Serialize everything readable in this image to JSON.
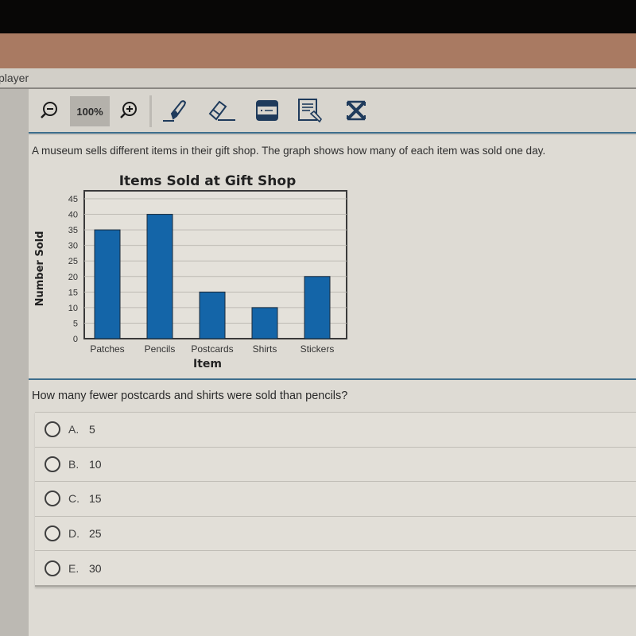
{
  "window": {
    "title_fragment": "player"
  },
  "toolbar": {
    "zoom_level": "100%",
    "tools": [
      {
        "name": "zoom-out",
        "icon": "zoom-out-icon"
      },
      {
        "name": "zoom-in",
        "icon": "zoom-in-icon"
      },
      {
        "name": "highlighter",
        "icon": "highlighter-icon"
      },
      {
        "name": "eraser",
        "icon": "eraser-icon"
      },
      {
        "name": "line-reader",
        "icon": "line-reader-icon"
      },
      {
        "name": "notepad",
        "icon": "notepad-icon"
      },
      {
        "name": "answer-eliminator",
        "icon": "answer-eliminator-icon"
      }
    ],
    "accent_color": "#1f3b5c"
  },
  "passage": "A museum sells different items in their gift shop. The graph shows how many of each item was sold one day.",
  "chart_data": {
    "type": "bar",
    "title": "Items Sold at Gift Shop",
    "xlabel": "Item",
    "ylabel": "Number Sold",
    "categories": [
      "Patches",
      "Pencils",
      "Postcards",
      "Shirts",
      "Stickers"
    ],
    "values": [
      35,
      40,
      15,
      10,
      20
    ],
    "ylim": [
      0,
      45
    ],
    "yticks": [
      0,
      5,
      10,
      15,
      20,
      25,
      30,
      35,
      40,
      45
    ],
    "grid": true,
    "bar_color": "#1465a8"
  },
  "question": "How many fewer postcards and shirts were sold than pencils?",
  "choices": [
    {
      "letter": "A.",
      "value": "5"
    },
    {
      "letter": "B.",
      "value": "10"
    },
    {
      "letter": "C.",
      "value": "15"
    },
    {
      "letter": "D.",
      "value": "25"
    },
    {
      "letter": "E.",
      "value": "30"
    }
  ]
}
